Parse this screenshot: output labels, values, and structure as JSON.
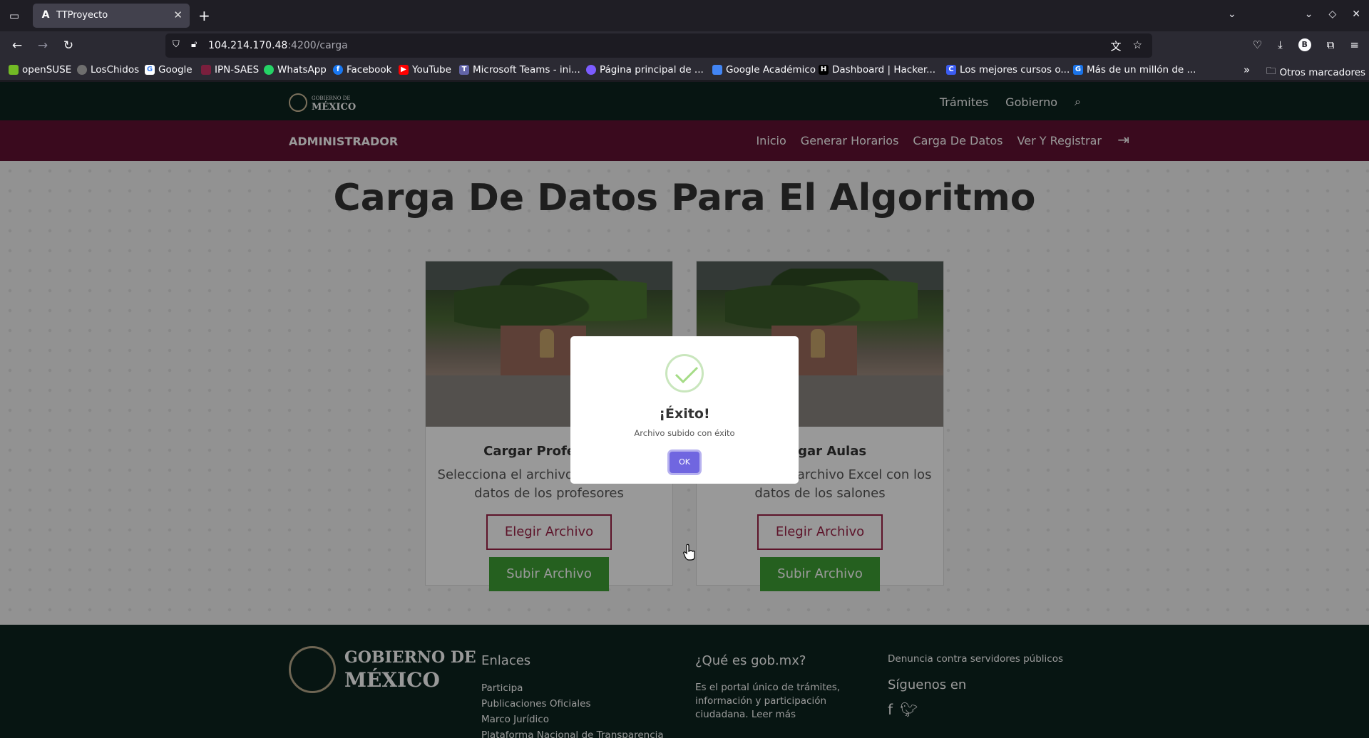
{
  "browser": {
    "tab_title": "TTProyecto",
    "tab_favicon": "A",
    "url_host": "104.214.170.48",
    "url_path": ":4200/carga",
    "bookmarks": [
      {
        "label": "openSUSE",
        "color": "#73ba25"
      },
      {
        "label": "LosChidos",
        "color": "#6e6e6e"
      },
      {
        "label": "Google",
        "color": "#4285f4"
      },
      {
        "label": "IPN-SAES",
        "color": "#7a1f3d"
      },
      {
        "label": "WhatsApp",
        "color": "#25d366"
      },
      {
        "label": "Facebook",
        "color": "#1877f2"
      },
      {
        "label": "YouTube",
        "color": "#ff0000"
      },
      {
        "label": "Microsoft Teams - ini...",
        "color": "#6264a7"
      },
      {
        "label": "Página principal de ...",
        "color": "#7c5cff"
      },
      {
        "label": "Google Académico",
        "color": "#4285f4"
      },
      {
        "label": "Dashboard | Hacker...",
        "color": "#000000"
      },
      {
        "label": "Los mejores cursos o...",
        "color": "#3b5cf0"
      },
      {
        "label": "Más de un millón de ...",
        "color": "#1a73e8"
      }
    ],
    "other_bookmarks": "Otros marcadores"
  },
  "header": {
    "logo_small": "GOBIERNO DE",
    "logo_big": "MÉXICO",
    "links": [
      "Trámites",
      "Gobierno"
    ]
  },
  "admin": {
    "title": "ADMINISTRADOR",
    "links": [
      "Inicio",
      "Generar Horarios",
      "Carga De Datos",
      "Ver Y Registrar"
    ]
  },
  "main": {
    "title": "Carga De Datos Para El Algoritmo",
    "cards": [
      {
        "title": "Cargar Profesores",
        "text": "Selecciona el archivo Excel con los datos de los profesores",
        "choose": "Elegir Archivo",
        "upload": "Subir Archivo"
      },
      {
        "title": "Cargar Aulas",
        "text": "Selecciona el archivo Excel con los datos de los salones",
        "choose": "Elegir Archivo",
        "upload": "Subir Archivo"
      }
    ]
  },
  "footer": {
    "logo_a": "GOBIERNO DE",
    "logo_b": "MÉXICO",
    "enlaces_title": "Enlaces",
    "enlaces": [
      "Participa",
      "Publicaciones Oficiales",
      "Marco Jurídico",
      "Plataforma Nacional de Transparencia"
    ],
    "que_es_title": "¿Qué es gob.mx?",
    "que_es_text": "Es el portal único de trámites, información y participación ciudadana. Leer más",
    "denuncia": "Denuncia contra servidores públicos",
    "siguenos": "Síguenos en"
  },
  "modal": {
    "title": "¡Éxito!",
    "text": "Archivo subido con éxito",
    "ok": "OK"
  }
}
